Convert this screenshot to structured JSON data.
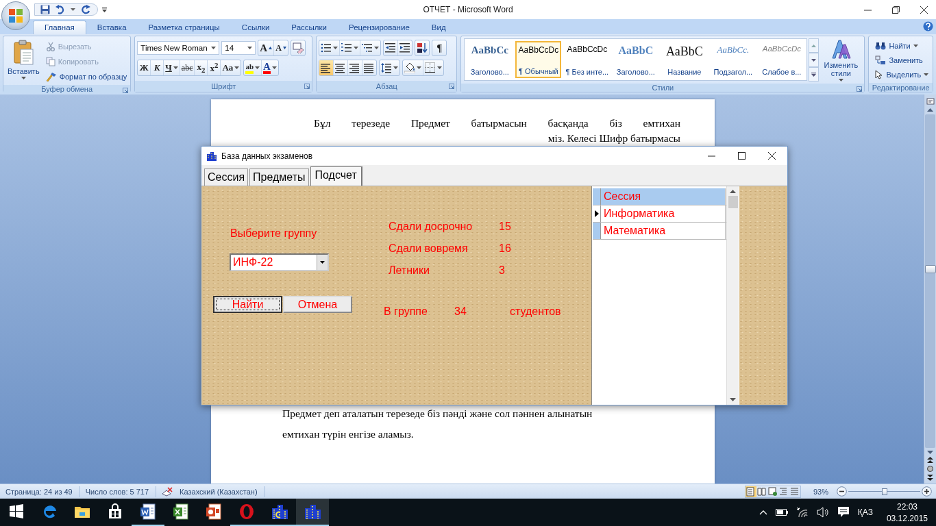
{
  "word": {
    "title": "ОТЧЕТ - Microsoft Word",
    "tabs": [
      {
        "label": "Главная",
        "selected": true
      },
      {
        "label": "Вставка",
        "selected": false
      },
      {
        "label": "Разметка страницы",
        "selected": false
      },
      {
        "label": "Ссылки",
        "selected": false
      },
      {
        "label": "Рассылки",
        "selected": false
      },
      {
        "label": "Рецензирование",
        "selected": false
      },
      {
        "label": "Вид",
        "selected": false
      }
    ],
    "clipboard": {
      "label": "Буфер обмена",
      "paste": "Вставить",
      "items": [
        {
          "kind": "cut",
          "label": "Вырезать",
          "disabled": true
        },
        {
          "kind": "copy",
          "label": "Копировать",
          "disabled": true
        },
        {
          "kind": "painter",
          "label": "Формат по образцу",
          "disabled": false
        }
      ]
    },
    "font": {
      "label": "Шрифт",
      "font_name": "Times New Roman",
      "font_size": "14",
      "size_buttons": [
        "A",
        "A"
      ],
      "format_buttons": [
        {
          "kind": "bold",
          "label": "Ж",
          "dropdown": false
        },
        {
          "kind": "italic",
          "label": "К",
          "dropdown": false
        },
        {
          "kind": "underline",
          "label": "Ч",
          "dropdown": true
        },
        {
          "kind": "strike",
          "label": "abc",
          "dropdown": false
        },
        {
          "kind": "plain",
          "label": "x$_{2}$",
          "dropdown": false
        },
        {
          "kind": "plain",
          "label": "x$^{2}$",
          "dropdown": false
        },
        {
          "kind": "plain",
          "label": "Aa",
          "dropdown": true
        }
      ],
      "color_buttons": [
        {
          "label": "ab",
          "color": "#ffff00"
        },
        {
          "label": "A",
          "color": "#ff0000"
        }
      ]
    },
    "paragraph": {
      "label": "Абзац",
      "show_marks": "¶",
      "align_buttons": [
        {
          "kind": "left",
          "selected": true
        },
        {
          "kind": "center",
          "selected": false
        },
        {
          "kind": "right",
          "selected": false
        },
        {
          "kind": "justify",
          "selected": false
        }
      ]
    },
    "styles": {
      "label": "Стили",
      "change_button": "Изменить стили",
      "items": [
        {
          "kind": "heading1",
          "sample": "AaBbCc",
          "name": "Заголово...",
          "selected": false
        },
        {
          "kind": "normal",
          "sample": "AaBbCcDc",
          "name": "¶ Обычный",
          "selected": true
        },
        {
          "kind": "normal",
          "sample": "AaBbCcDc",
          "name": "¶ Без инте...",
          "selected": false
        },
        {
          "kind": "heading2",
          "sample": "AaBbC",
          "name": "Заголово...",
          "selected": false
        },
        {
          "kind": "title",
          "sample": "AaBbC",
          "name": "Название",
          "selected": false
        },
        {
          "kind": "subtitle",
          "sample": "AaBbCc.",
          "name": "Подзагол...",
          "selected": false
        },
        {
          "kind": "emphasis",
          "sample": "AaBbCcDc",
          "name": "Слабое в...",
          "selected": false
        }
      ]
    },
    "editing": {
      "label": "Редактирование",
      "items": [
        {
          "kind": "find",
          "label": "Найти"
        },
        {
          "kind": "replace",
          "label": "Заменить"
        },
        {
          "kind": "select",
          "label": "Выделить"
        }
      ]
    }
  },
  "document": {
    "lines_above": [
      "Бұл терезеде Предмет батырмасын басқанда біз емтихан",
      "міз. Келесі Шифр батырмасы"
    ],
    "lines_below": [
      "Предмет деп аталатын терезеде біз пәнді және сол пәннен алынатын",
      "емтихан түрін енгізе аламыз."
    ]
  },
  "status_bar": {
    "items": [
      "Страница: 24 из 49",
      "Число слов: 5 717",
      "Казахский (Казахстан)"
    ],
    "views": [
      {
        "kind": "print",
        "selected": true
      },
      {
        "kind": "reading",
        "selected": false
      },
      {
        "kind": "web",
        "selected": false
      },
      {
        "kind": "outline",
        "selected": false
      },
      {
        "kind": "draft",
        "selected": false
      }
    ],
    "zoom": {
      "reading": "93%",
      "level": 0.5
    }
  },
  "dialog": {
    "title": "База данных экзаменов",
    "tabs": [
      {
        "label": "Сессия",
        "selected": false
      },
      {
        "label": "Предметы",
        "selected": false
      },
      {
        "label": "Подсчет",
        "selected": true
      }
    ],
    "group_label": "Выберите группу",
    "group_field": {
      "value": "ИНФ-22"
    },
    "buttons": [
      {
        "label": "Найти",
        "focused": true
      },
      {
        "label": "Отмена",
        "focused": false
      }
    ],
    "stats": [
      {
        "label": "Сдали досрочно",
        "value": "15"
      },
      {
        "label": "Сдали вовремя",
        "value": "16"
      },
      {
        "label": "Летники",
        "value": "3"
      }
    ],
    "total": {
      "label": "В группе",
      "value": "34",
      "unit": "студентов"
    },
    "grid": {
      "column": "Сессия",
      "rows": [
        {
          "text": "Информатика",
          "selected": true
        },
        {
          "text": "Математика",
          "selected": false
        }
      ]
    }
  },
  "taskbar": {
    "apps": [
      {
        "kind": "start",
        "running": false,
        "selected": false
      },
      {
        "kind": "edge",
        "running": false,
        "selected": false
      },
      {
        "kind": "folder",
        "running": false,
        "selected": false
      },
      {
        "kind": "store",
        "running": false,
        "selected": false
      },
      {
        "kind": "word",
        "running": true,
        "selected": false
      },
      {
        "kind": "excel",
        "running": false,
        "selected": false
      },
      {
        "kind": "slides",
        "running": false,
        "selected": false
      },
      {
        "kind": "opera",
        "running": true,
        "selected": false
      },
      {
        "kind": "cpp",
        "running": true,
        "selected": false
      },
      {
        "kind": "db",
        "running": true,
        "selected": true
      }
    ],
    "language": "ҚАЗ",
    "time": "22:03",
    "date": "03.12.2015"
  }
}
